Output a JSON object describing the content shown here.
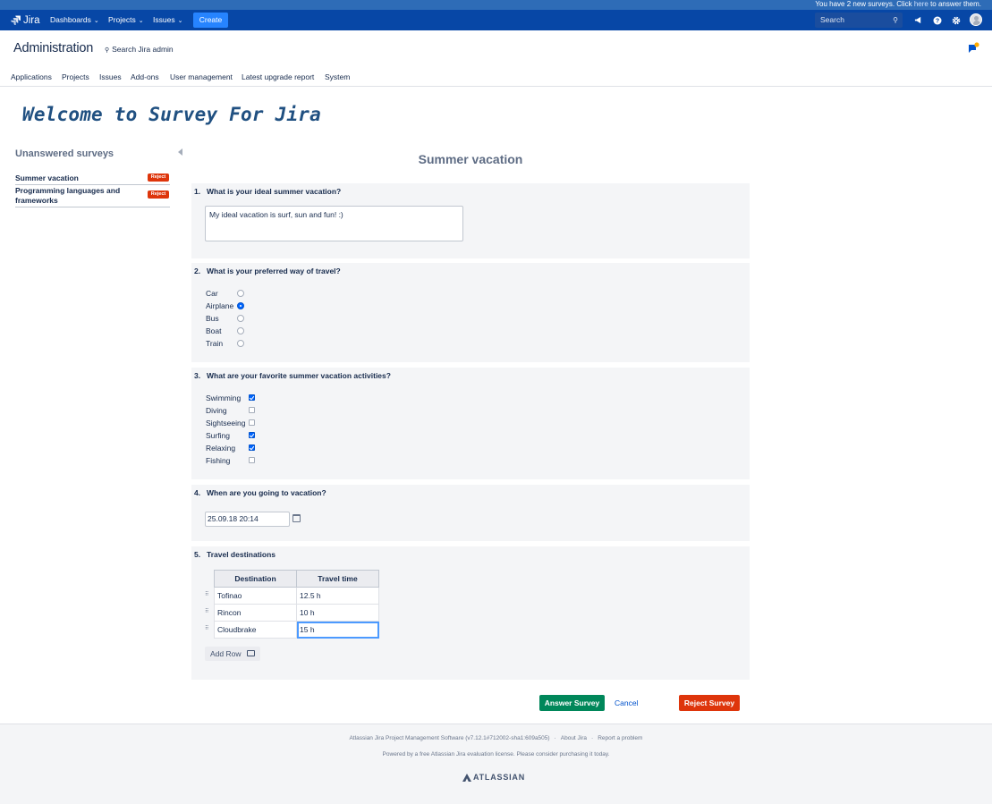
{
  "announcement": {
    "prefix": "You have 2 new surveys. Click ",
    "link": "here",
    "suffix": " to answer them."
  },
  "topnav": {
    "logo": "Jira",
    "dashboards": "Dashboards",
    "projects": "Projects",
    "issues": "Issues",
    "create": "Create",
    "search_placeholder": "Search",
    "icons": [
      "megaphone-icon",
      "help-icon",
      "gear-icon",
      "avatar"
    ]
  },
  "admin": {
    "title": "Administration",
    "search": "Search Jira admin",
    "tabs": [
      "Applications",
      "Projects",
      "Issues",
      "Add-ons",
      "User management",
      "Latest upgrade report",
      "System"
    ]
  },
  "welcome": "Welcome to Survey For Jira",
  "sidebar": {
    "heading": "Unanswered surveys",
    "items": [
      {
        "label": "Summer vacation",
        "badge": "Reject"
      },
      {
        "label": "Programming languages and frameworks",
        "badge": "Reject"
      }
    ]
  },
  "survey": {
    "title": "Summer vacation",
    "q1": {
      "num": "1.",
      "text": "What is your ideal summer vacation?",
      "answer": "My ideal vacation is surf, sun and fun! :)"
    },
    "q2": {
      "num": "2.",
      "text": "What is your preferred way of travel?",
      "options": [
        "Car",
        "Airplane",
        "Bus",
        "Boat",
        "Train"
      ],
      "selected": "Airplane"
    },
    "q3": {
      "num": "3.",
      "text": "What are your favorite summer vacation activities?",
      "options": [
        "Swimming",
        "Diving",
        "Sightseeing",
        "Surfing",
        "Relaxing",
        "Fishing"
      ],
      "checked": [
        "Swimming",
        "Surfing",
        "Relaxing"
      ]
    },
    "q4": {
      "num": "4.",
      "text": "When are you going to vacation?",
      "value": "25.09.18 20:14"
    },
    "q5": {
      "num": "5.",
      "text": "Travel destinations",
      "columns": [
        "Destination",
        "Travel time"
      ],
      "rows": [
        [
          "Tofinao",
          "12.5 h"
        ],
        [
          "Rincon",
          "10 h"
        ],
        [
          "Cloudbrake",
          "15 h"
        ]
      ],
      "add_row": "Add Row"
    }
  },
  "buttons": {
    "answer": "Answer Survey",
    "cancel": "Cancel",
    "reject": "Reject Survey"
  },
  "footer": {
    "line1": "Atlassian Jira Project Management Software (v7.12.1#712002-sha1:609a505)",
    "about": "About Jira",
    "report": "Report a problem",
    "line2": "Powered by a free Atlassian Jira evaluation license. Please consider purchasing it today.",
    "brand": "ATLASSIAN"
  },
  "colors": {
    "nav": "#0747a6",
    "create": "#2684ff",
    "answer": "#00875a",
    "reject": "#de350b",
    "welcome": "#205081"
  }
}
